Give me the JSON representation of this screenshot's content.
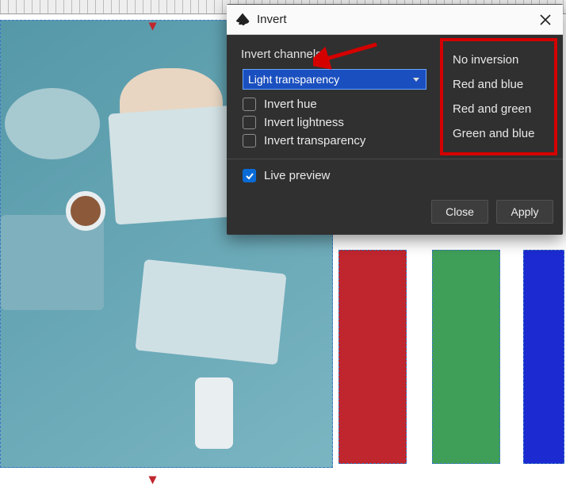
{
  "dialog": {
    "title": "Invert",
    "channels_label": "Invert channels:",
    "select_value": "Light transparency",
    "checks": {
      "invert_hue": "Invert hue",
      "invert_lightness": "Invert lightness",
      "invert_transparency": "Invert transparency",
      "live_preview": "Live preview"
    },
    "buttons": {
      "close": "Close",
      "apply": "Apply"
    }
  },
  "callout": {
    "options": {
      "no_inversion": "No inversion",
      "red_blue": "Red and blue",
      "red_green": "Red and green",
      "green_blue": "Green and blue"
    }
  },
  "colors": {
    "red": "#c0262e",
    "green": "#3f9f59",
    "blue": "#1c2bd1",
    "annotation": "#d40000"
  },
  "guide_glyph": "▾"
}
